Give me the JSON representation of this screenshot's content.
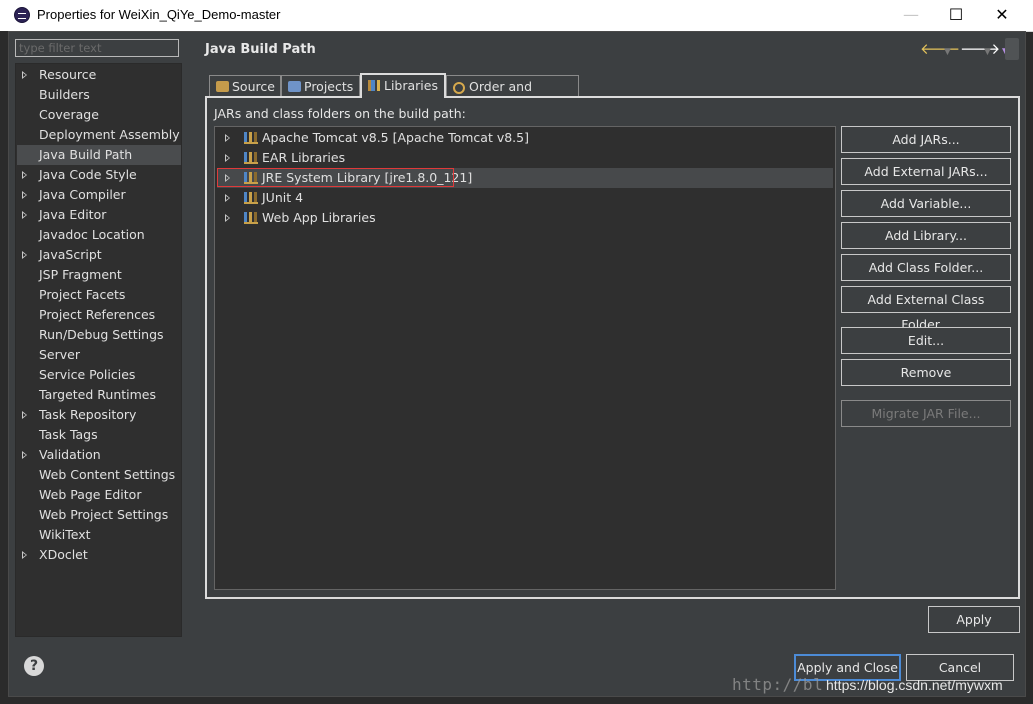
{
  "window": {
    "title": "Properties for WeiXin_QiYe_Demo-master",
    "minimize": "—",
    "maximize": "☐",
    "close": "✕"
  },
  "sidebar": {
    "filter_placeholder": "type filter text",
    "items": [
      {
        "label": "Resource",
        "expandable": true
      },
      {
        "label": "Builders",
        "expandable": false
      },
      {
        "label": "Coverage",
        "expandable": false
      },
      {
        "label": "Deployment Assembly",
        "expandable": false
      },
      {
        "label": "Java Build Path",
        "expandable": false,
        "selected": true
      },
      {
        "label": "Java Code Style",
        "expandable": true
      },
      {
        "label": "Java Compiler",
        "expandable": true
      },
      {
        "label": "Java Editor",
        "expandable": true
      },
      {
        "label": "Javadoc Location",
        "expandable": false
      },
      {
        "label": "JavaScript",
        "expandable": true
      },
      {
        "label": "JSP Fragment",
        "expandable": false
      },
      {
        "label": "Project Facets",
        "expandable": false
      },
      {
        "label": "Project References",
        "expandable": false
      },
      {
        "label": "Run/Debug Settings",
        "expandable": false
      },
      {
        "label": "Server",
        "expandable": false
      },
      {
        "label": "Service Policies",
        "expandable": false
      },
      {
        "label": "Targeted Runtimes",
        "expandable": false
      },
      {
        "label": "Task Repository",
        "expandable": true
      },
      {
        "label": "Task Tags",
        "expandable": false
      },
      {
        "label": "Validation",
        "expandable": true
      },
      {
        "label": "Web Content Settings",
        "expandable": false
      },
      {
        "label": "Web Page Editor",
        "expandable": false
      },
      {
        "label": "Web Project Settings",
        "expandable": false
      },
      {
        "label": "WikiText",
        "expandable": false
      },
      {
        "label": "XDoclet",
        "expandable": true
      }
    ]
  },
  "page": {
    "title": "Java Build Path",
    "nav_back": "🡐",
    "nav_forward": "🡒",
    "nav_dropdown": "▼"
  },
  "tabs": [
    {
      "label": "Source",
      "icon": "source-icon"
    },
    {
      "label": "Projects",
      "icon": "projects-icon"
    },
    {
      "label": "Libraries",
      "icon": "libraries-icon",
      "active": true
    },
    {
      "label": "Order and Export",
      "icon": "order-export-icon"
    }
  ],
  "libraries": {
    "section_label": "JARs and class folders on the build path:",
    "items": [
      {
        "label": "Apache Tomcat v8.5 [Apache Tomcat v8.5]"
      },
      {
        "label": "EAR Libraries"
      },
      {
        "label": "JRE System Library [jre1.8.0_121]",
        "selected": true
      },
      {
        "label": "JUnit 4"
      },
      {
        "label": "Web App Libraries"
      }
    ]
  },
  "buttons": {
    "add_jars": "Add JARs...",
    "add_external_jars": "Add External JARs...",
    "add_variable": "Add Variable...",
    "add_library": "Add Library...",
    "add_class_folder": "Add Class Folder...",
    "add_external_class_folder": "Add External Class Folder...",
    "edit": "Edit...",
    "remove": "Remove",
    "migrate_jar": "Migrate JAR File...",
    "apply": "Apply",
    "apply_and_close": "Apply and Close",
    "cancel": "Cancel"
  },
  "help_glyph": "?",
  "watermark": {
    "left": "http://bl",
    "right": "https://blog.csdn.net/mywxm"
  },
  "colors": {
    "background": "#3c3f41",
    "tree_background": "#2f2f2f",
    "selection": "#4a4c4e",
    "highlight_border": "#e03a3a",
    "default_button_border": "#4c8bd6"
  }
}
